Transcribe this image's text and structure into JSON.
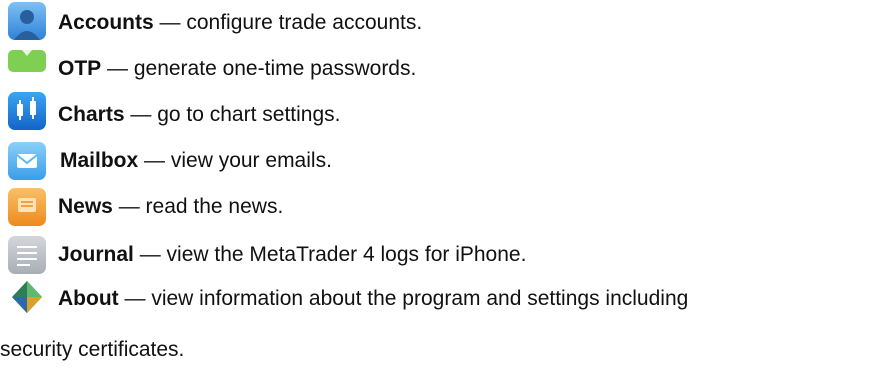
{
  "items": [
    {
      "title": "Accounts",
      "desc": " — configure trade accounts.",
      "icon": "accounts-icon",
      "color": "#4a9ae6"
    },
    {
      "title": "OTP",
      "desc": " — generate one-time passwords.",
      "icon": "otp-icon",
      "color": "#7fcf52"
    },
    {
      "title": "Charts",
      "desc": " — go to chart settings.",
      "icon": "charts-icon",
      "color": "#1e8bea"
    },
    {
      "title": "Mailbox",
      "desc": " — view your emails.",
      "icon": "mailbox-icon",
      "color": "#5cb7f2"
    },
    {
      "title": "News",
      "desc": " — read the news.",
      "icon": "news-icon",
      "color": "#f4a53c"
    },
    {
      "title": "Journal",
      "desc": " — view the MetaTrader 4 logs for iPhone.",
      "icon": "journal-icon",
      "color": "#b9bcc3"
    },
    {
      "title": "About",
      "desc": " — view information about the program and settings including",
      "icon": "about-icon",
      "color": "#3c8f5a"
    }
  ],
  "about_wrap": "security certificates."
}
